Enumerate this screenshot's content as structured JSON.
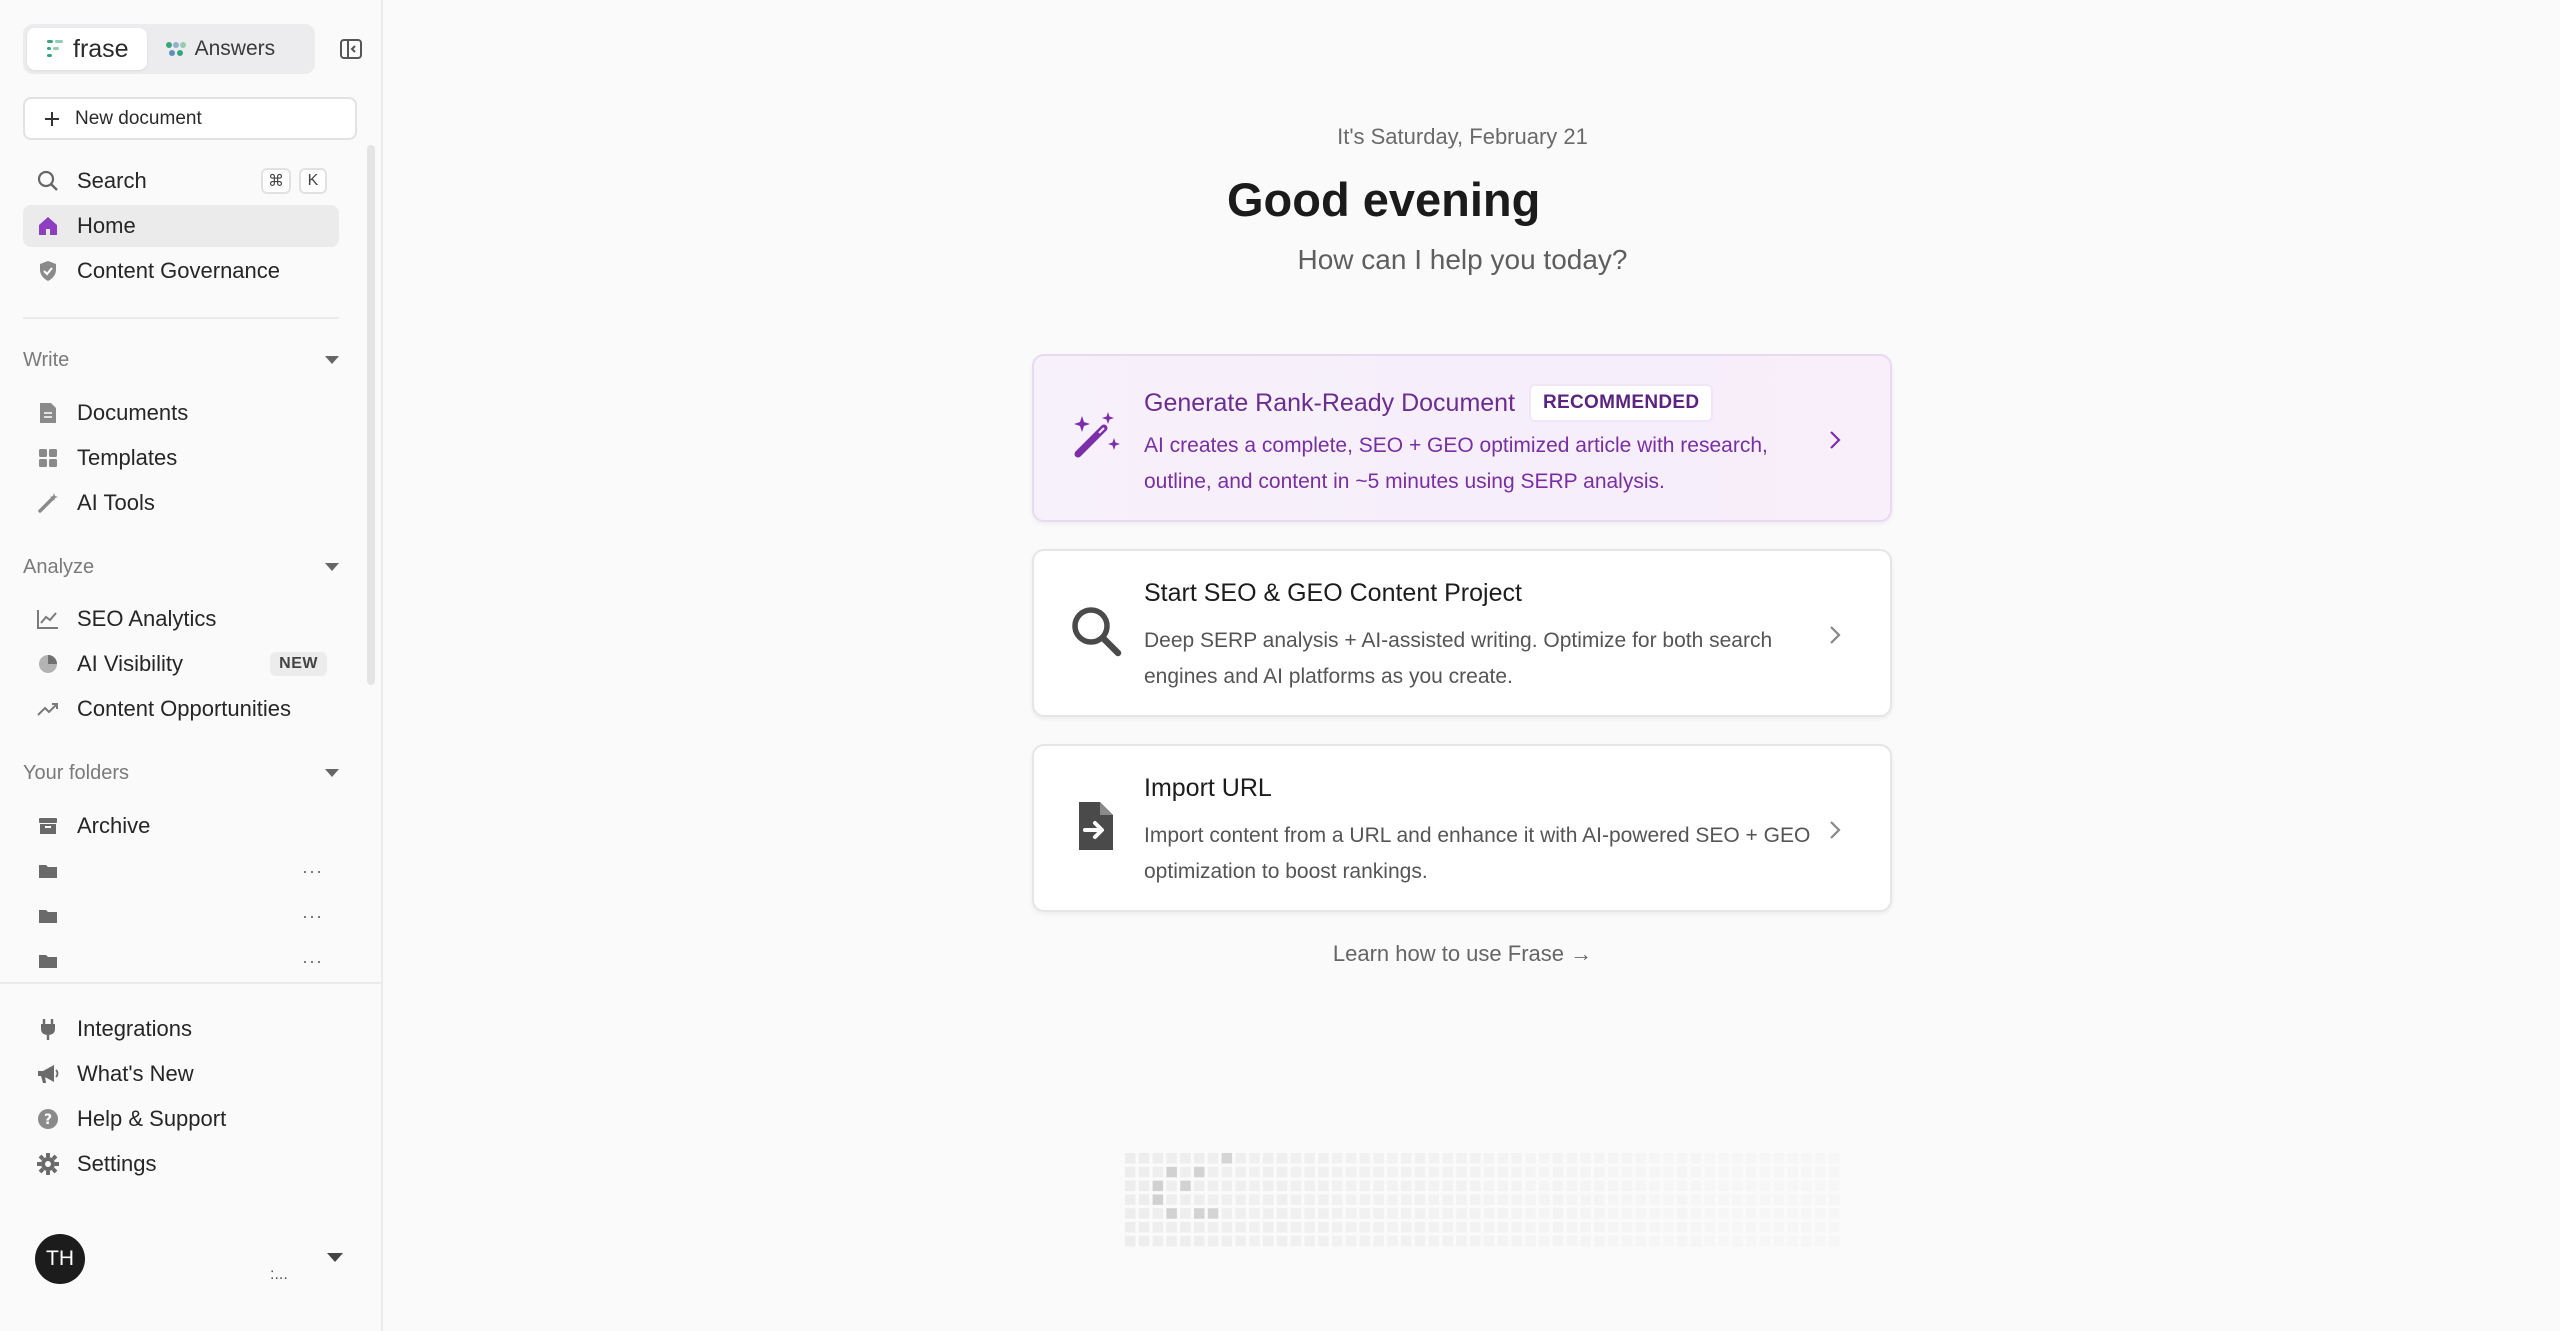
{
  "brand": {
    "primary": "frase",
    "secondary": "Answers"
  },
  "sidebar": {
    "new_document": "New document",
    "search": {
      "label": "Search",
      "keys": [
        "⌘",
        "K"
      ]
    },
    "top_items": [
      {
        "label": "Home",
        "icon": "home-icon",
        "active": true
      },
      {
        "label": "Content Governance",
        "icon": "shield-icon"
      }
    ],
    "sections": {
      "write": {
        "title": "Write",
        "items": [
          {
            "label": "Documents",
            "icon": "document-icon"
          },
          {
            "label": "Templates",
            "icon": "grid-icon"
          },
          {
            "label": "AI Tools",
            "icon": "magic-wand-icon"
          }
        ]
      },
      "analyze": {
        "title": "Analyze",
        "items": [
          {
            "label": "SEO Analytics",
            "icon": "line-chart-icon"
          },
          {
            "label": "AI Visibility",
            "icon": "pie-chart-icon",
            "badge": "NEW"
          },
          {
            "label": "Content Opportunities",
            "icon": "trending-icon"
          }
        ]
      },
      "folders": {
        "title": "Your folders",
        "archive": "Archive",
        "more": "···"
      }
    },
    "bottom_items": [
      {
        "label": "Integrations",
        "icon": "plug-icon"
      },
      {
        "label": "What's New",
        "icon": "megaphone-icon"
      },
      {
        "label": "Help & Support",
        "icon": "help-icon"
      },
      {
        "label": "Settings",
        "icon": "gear-icon"
      }
    ],
    "user": {
      "initials": "TH",
      "extra": ":..."
    }
  },
  "main": {
    "date": "It's Saturday, February 21",
    "greeting": "Good evening",
    "subtitle": "How can I help you today?",
    "cards": [
      {
        "title": "Generate Rank-Ready Document",
        "badge": "RECOMMENDED",
        "description": "AI creates a complete, SEO + GEO optimized article with research, outline, and content in ~5 minutes using SERP analysis.",
        "icon": "sparkle-wand-icon"
      },
      {
        "title": "Start SEO & GEO Content Project",
        "description": "Deep SERP analysis + AI-assisted writing. Optimize for both search engines and AI platforms as you create.",
        "icon": "search-icon"
      },
      {
        "title": "Import URL",
        "description": "Import content from a URL and enhance it with AI-powered SEO + GEO optimization to boost rankings.",
        "icon": "file-import-icon"
      }
    ],
    "learn_link": "Learn how to use Frase →"
  },
  "colors": {
    "accent": "#7b2fa8",
    "accent_bg": "#f6effb",
    "text": "#1f1f1f"
  }
}
